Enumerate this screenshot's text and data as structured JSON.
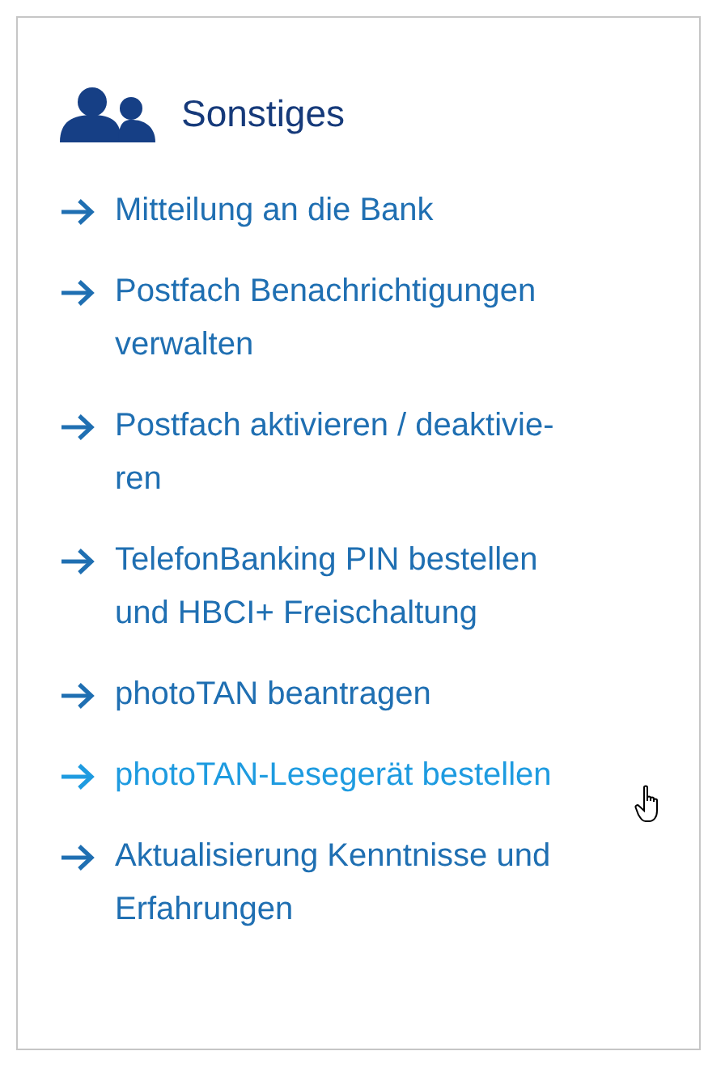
{
  "panel": {
    "title": "Sonstiges",
    "links": [
      {
        "lines": [
          "Mitteilung an die Bank"
        ],
        "hovered": false
      },
      {
        "lines": [
          "Postfach Benachrichtigungen",
          "verwalten"
        ],
        "hovered": false
      },
      {
        "lines": [
          "Postfach aktivieren / deaktivie-",
          "ren"
        ],
        "hovered": false
      },
      {
        "lines": [
          "TelefonBanking PIN bestellen",
          "und HBCI+ Freischaltung"
        ],
        "hovered": false
      },
      {
        "lines": [
          "photoTAN beantragen"
        ],
        "hovered": false
      },
      {
        "lines": [
          "photoTAN-Lesegerät bestellen"
        ],
        "hovered": true
      },
      {
        "lines": [
          "Aktualisierung Kenntnisse und",
          "Erfahrungen"
        ],
        "hovered": false
      }
    ]
  }
}
